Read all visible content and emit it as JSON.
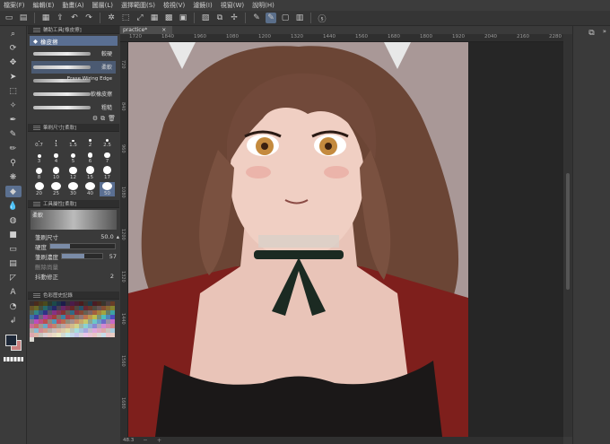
{
  "menu": [
    "檔案(F)",
    "編輯(E)",
    "動畫(A)",
    "圖層(L)",
    "選擇範圍(S)",
    "檢視(V)",
    "濾鏡(I)",
    "視窗(W)",
    "說明(H)"
  ],
  "subtool_panel": {
    "header": "輔助工具[橡皮擦]",
    "group": "橡皮擦",
    "brushes": [
      {
        "label": "較硬",
        "selected": false
      },
      {
        "label": "柔軟",
        "selected": true
      },
      {
        "label": "Erase Wiring Edge",
        "selected": false
      },
      {
        "label": "軟橡皮擦",
        "selected": false
      },
      {
        "label": "粗糙",
        "selected": false
      }
    ]
  },
  "brush_size_panel": {
    "header": "筆刷尺寸[柔軟]",
    "sizes": [
      "0.7",
      "1",
      "1.5",
      "2",
      "2.5",
      "3",
      "4",
      "5",
      "6",
      "7",
      "8",
      "10",
      "12",
      "15",
      "17",
      "20",
      "25",
      "30",
      "40",
      "50"
    ],
    "selected": "50"
  },
  "tool_property_panel": {
    "header": "工具屬性[柔軟]",
    "preset_name": "柔軟",
    "brush_size_label": "筆刷尺寸",
    "brush_size_value": "50.0",
    "hardness_label": "硬度",
    "density_label": "筆刷濃度",
    "density_value": "57",
    "direction_label": "刪除尚量",
    "stabilization_label": "抖動修正",
    "stabilization_value": "2"
  },
  "color_panel": {
    "header": "色彩歷史記錄"
  },
  "document": {
    "tab_label": "practice*",
    "ruler_ticks": [
      "1720",
      "1840",
      "1960",
      "1080",
      "1200",
      "1320",
      "1440",
      "1560",
      "1680",
      "1800",
      "1920",
      "2040",
      "2160",
      "2280"
    ],
    "left_ticks": [
      "720",
      "840",
      "960",
      "1080",
      "1200",
      "1320",
      "1440",
      "1560",
      "1680"
    ],
    "zoom": "48.3"
  },
  "colors": {
    "accent": "#5a6f92",
    "background_canvas": "#a99897",
    "main_color": "#1e2838",
    "sub_color": "#c97f7f"
  }
}
